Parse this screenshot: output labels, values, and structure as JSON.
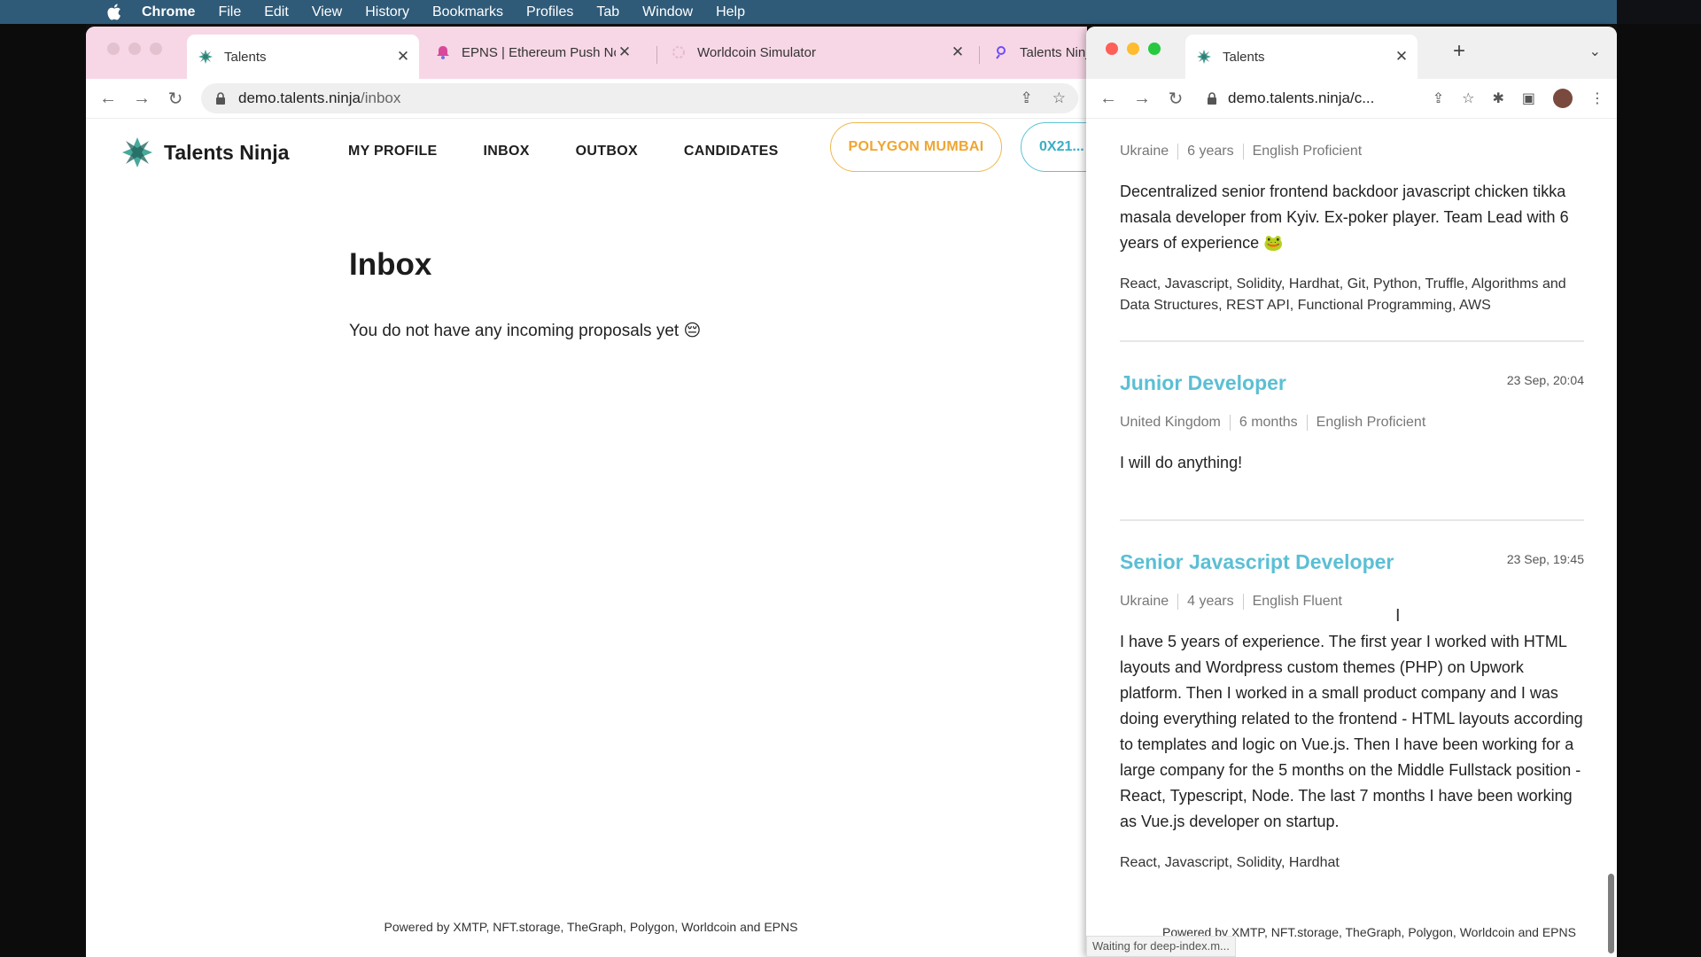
{
  "menubar": {
    "app": "Chrome",
    "items": [
      "File",
      "Edit",
      "View",
      "History",
      "Bookmarks",
      "Profiles",
      "Tab",
      "Window",
      "Help"
    ]
  },
  "left_window": {
    "tabs": [
      {
        "title": "Talents",
        "active": true
      },
      {
        "title": "EPNS | Ethereum Push Notif"
      },
      {
        "title": "Worldcoin Simulator"
      },
      {
        "title": "Talents Ninja Subgraph"
      }
    ],
    "url_host": "demo.talents.ninja",
    "url_path": "/inbox",
    "site": {
      "brand": "Talents Ninja",
      "nav": [
        "MY PROFILE",
        "INBOX",
        "OUTBOX",
        "CANDIDATES"
      ],
      "network": "POLYGON MUMBAI",
      "address": "0X21..."
    },
    "inbox_title": "Inbox",
    "inbox_message": "You do not have any incoming proposals yet 😔",
    "footer": "Powered by XMTP, NFT.storage, TheGraph, Polygon, Worldcoin and EPNS"
  },
  "right_window": {
    "tab_title": "Talents",
    "url": "demo.talents.ninja/c...",
    "cards": [
      {
        "meta": [
          "Ukraine",
          "6 years",
          "English Proficient"
        ],
        "description": "Decentralized senior frontend backdoor javascript chicken tikka masala developer from Kyiv. Ex-poker player. Team Lead with 6 years of experience 🐸",
        "skills": "React, Javascript, Solidity, Hardhat, Git, Python, Truffle, Algorithms and Data Structures, REST API, Functional Programming, AWS"
      },
      {
        "title": "Junior Developer",
        "timestamp": "23 Sep, 20:04",
        "meta": [
          "United Kingdom",
          "6 months",
          "English Proficient"
        ],
        "description": "I will do anything!"
      },
      {
        "title": "Senior Javascript Developer",
        "timestamp": "23 Sep, 19:45",
        "meta": [
          "Ukraine",
          "4 years",
          "English Fluent"
        ],
        "description": "I have 5 years of experience. The first year I worked with HTML layouts and Wordpress custom themes (PHP) on Upwork platform. Then I worked in a small product company and I was doing everything related to the frontend - HTML layouts according to templates and logic on Vue.js. Then I have been working for a large company for the 5 months on the Middle Fullstack position - React, Typescript, Node. The last 7 months I have been working as Vue.js developer on startup.",
        "skills": "React, Javascript, Solidity, Hardhat"
      }
    ],
    "footer": "Powered by XMTP, NFT.storage, TheGraph, Polygon, Worldcoin and EPNS",
    "status": "Waiting for deep-index.m..."
  }
}
